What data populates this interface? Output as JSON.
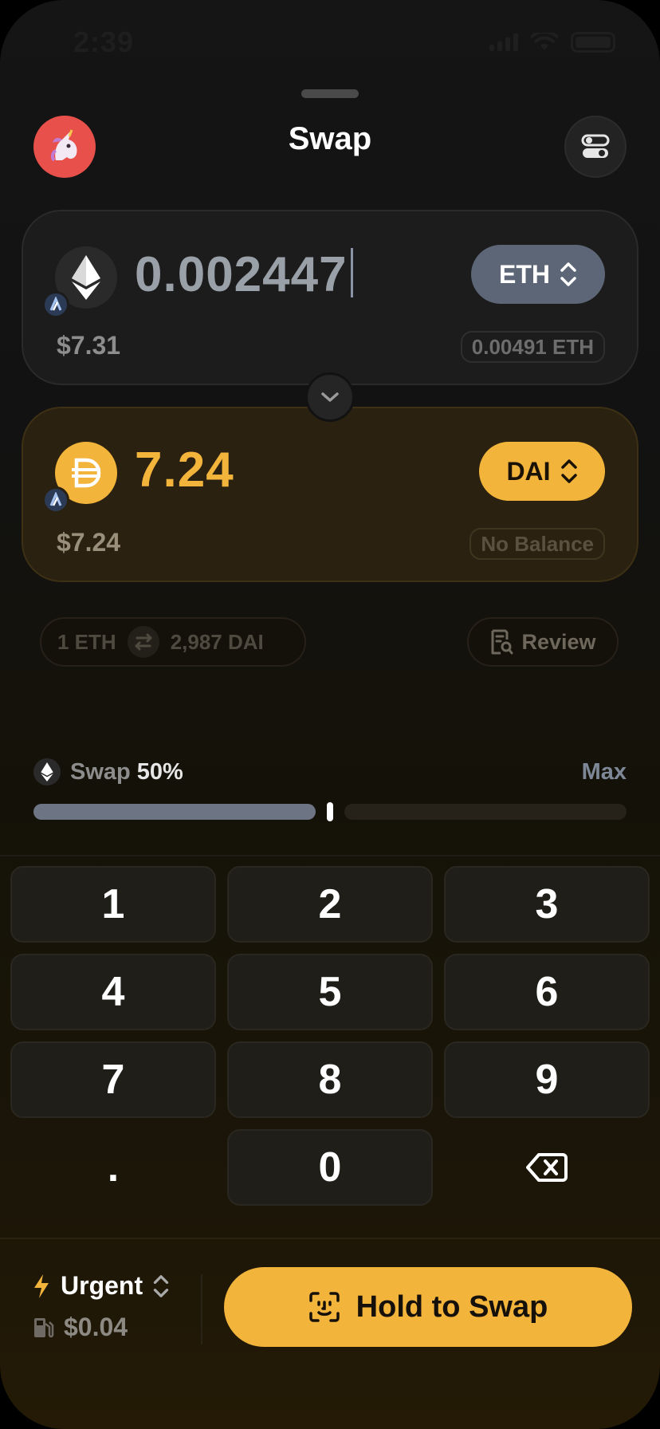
{
  "status_bar": {
    "time": "2:39",
    "signal_icon": "signal-icon",
    "wifi_icon": "wifi-icon",
    "battery_icon": "battery-icon"
  },
  "header": {
    "title": "Swap",
    "avatar_icon": "unicorn-icon",
    "settings_icon": "toggle-settings-icon"
  },
  "from": {
    "amount": "0.002447",
    "token": "ETH",
    "usd": "$7.31",
    "balance": "0.00491 ETH",
    "icon": "eth-icon",
    "chain_icon": "arbitrum-icon"
  },
  "to": {
    "amount": "7.24",
    "token": "DAI",
    "usd": "$7.24",
    "balance": "No Balance",
    "icon": "dai-icon",
    "chain_icon": "arbitrum-icon"
  },
  "rate": {
    "left": "1 ETH",
    "right": "2,987 DAI"
  },
  "review": {
    "label": "Review"
  },
  "slider": {
    "label": "Swap",
    "percent_label": "50%",
    "max_label": "Max",
    "value_fraction": 0.5
  },
  "keypad": {
    "keys": [
      "1",
      "2",
      "3",
      "4",
      "5",
      "6",
      "7",
      "8",
      "9",
      ".",
      "0"
    ]
  },
  "footer": {
    "speed_label": "Urgent",
    "gas_fee": "$0.04",
    "hold_button": "Hold to Swap"
  },
  "colors": {
    "accent": "#f3b43c",
    "eth_pill": "#5d6676",
    "avatar": "#e8504b"
  }
}
